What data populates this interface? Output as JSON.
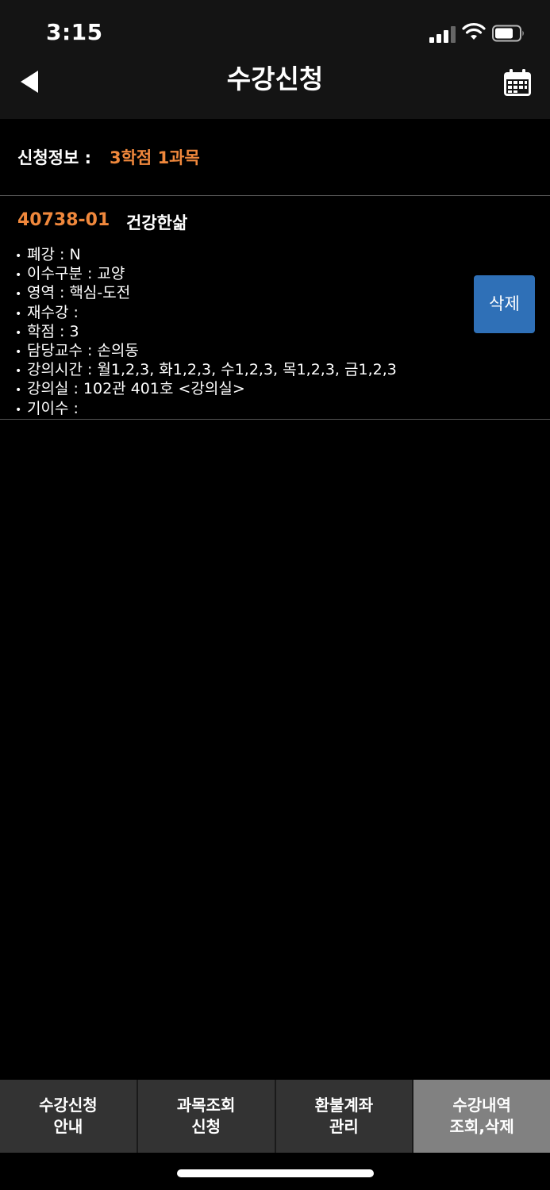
{
  "status_bar": {
    "time": "3:15"
  },
  "nav": {
    "title": "수강신청"
  },
  "summary": {
    "label": "신청정보 :",
    "value": "3학점 1과목"
  },
  "course": {
    "code": "40738-01",
    "name": "건강한삶",
    "details": [
      "폐강 : N",
      "이수구분 : 교양",
      "영역 : 핵심-도전",
      "재수강 :",
      "학점 : 3",
      "담당교수 : 손의동",
      "강의시간 : 월1,2,3, 화1,2,3, 수1,2,3, 목1,2,3, 금1,2,3",
      "강의실 : 102관 401호 <강의실>",
      "기이수 :"
    ],
    "delete_label": "삭제"
  },
  "tabs": [
    {
      "label": "수강신청\n안내",
      "active": false
    },
    {
      "label": "과목조회\n신청",
      "active": false
    },
    {
      "label": "환불계좌\n관리",
      "active": false
    },
    {
      "label": "수강내역\n조회,삭제",
      "active": true
    }
  ],
  "colors": {
    "accent": "#f0883c",
    "button": "#2f70b7",
    "bar": "#141414",
    "tab": "#333333",
    "tab_active": "#818181"
  },
  "icons": {
    "back": "back-arrow-icon",
    "calendar": "calendar-icon"
  }
}
